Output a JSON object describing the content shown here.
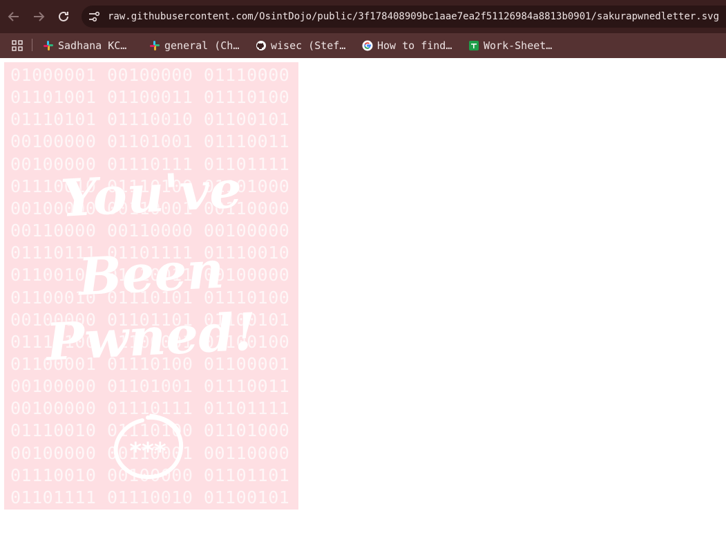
{
  "browser": {
    "url": "raw.githubusercontent.com/OsintDojo/public/3f178408909bc1aae7ea2f51126984a8813b0901/sakurapwnedletter.svg",
    "bookmarks": [
      {
        "label": "Sadhana KC…",
        "icon": "slack-icon"
      },
      {
        "label": "general (Ch…",
        "icon": "slack-icon"
      },
      {
        "label": "wisec (Stef…",
        "icon": "github-icon"
      },
      {
        "label": "How to find…",
        "icon": "google-icon"
      },
      {
        "label": "Work-Sheet…",
        "icon": "google-sheets-icon"
      }
    ]
  },
  "poster": {
    "binary_rows": [
      "01000001 00100000 01110000",
      "01101001 01100011 01110100",
      "01110101 01110010 01100101",
      "00100000 01101001 01110011",
      "00100000 01110111 01101111",
      "01110010 01110100 01101000",
      "00100000 00110001 00110000",
      "00110000 00110000 00100000",
      "01110111 01101111 01110010",
      "01100100 01110011 00100000",
      "01100010 01110101 01110100",
      "00100000 01101101 01100101",
      "01110100 01100001 01100100",
      "01100001 01110100 01100001",
      "00100000 01101001 01110011",
      "00100000 01110111 01101111",
      "01110010 01110100 01101000",
      "00100000 00110001 00110000",
      "01110010 00100000 01101101",
      "01101111 01110010 01100101"
    ],
    "headline": [
      "You've",
      "Been",
      "Pwned!"
    ],
    "signature_text": "***",
    "background_color": "#fedfe3"
  }
}
